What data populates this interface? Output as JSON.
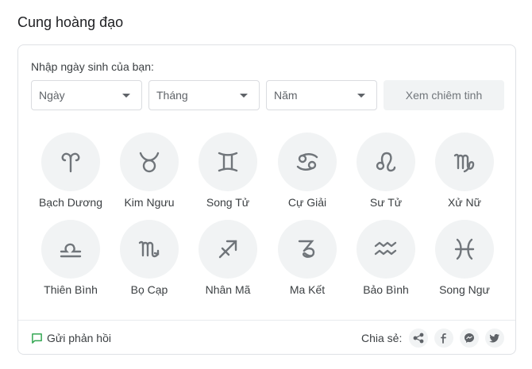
{
  "title": "Cung hoàng đạo",
  "prompt": "Nhập ngày sinh của bạn:",
  "selects": {
    "day": "Ngày",
    "month": "Tháng",
    "year": "Năm"
  },
  "horoscope_button": "Xem chiêm tinh",
  "signs": [
    {
      "label": "Bạch Dương",
      "icon": "aries-icon"
    },
    {
      "label": "Kim Ngưu",
      "icon": "taurus-icon"
    },
    {
      "label": "Song Tử",
      "icon": "gemini-icon"
    },
    {
      "label": "Cự Giải",
      "icon": "cancer-icon"
    },
    {
      "label": "Sư Tử",
      "icon": "leo-icon"
    },
    {
      "label": "Xử Nữ",
      "icon": "virgo-icon"
    },
    {
      "label": "Thiên Bình",
      "icon": "libra-icon"
    },
    {
      "label": "Bọ Cạp",
      "icon": "scorpio-icon"
    },
    {
      "label": "Nhân Mã",
      "icon": "sagittarius-icon"
    },
    {
      "label": "Ma Kết",
      "icon": "capricorn-icon"
    },
    {
      "label": "Bảo Bình",
      "icon": "aquarius-icon"
    },
    {
      "label": "Song Ngư",
      "icon": "pisces-icon"
    }
  ],
  "footer": {
    "feedback": "Gửi phản hồi",
    "share": "Chia sẻ:"
  },
  "colors": {
    "icon": "#70757a",
    "circle_bg": "#f1f3f4",
    "feedback_icon": "#34a853"
  }
}
